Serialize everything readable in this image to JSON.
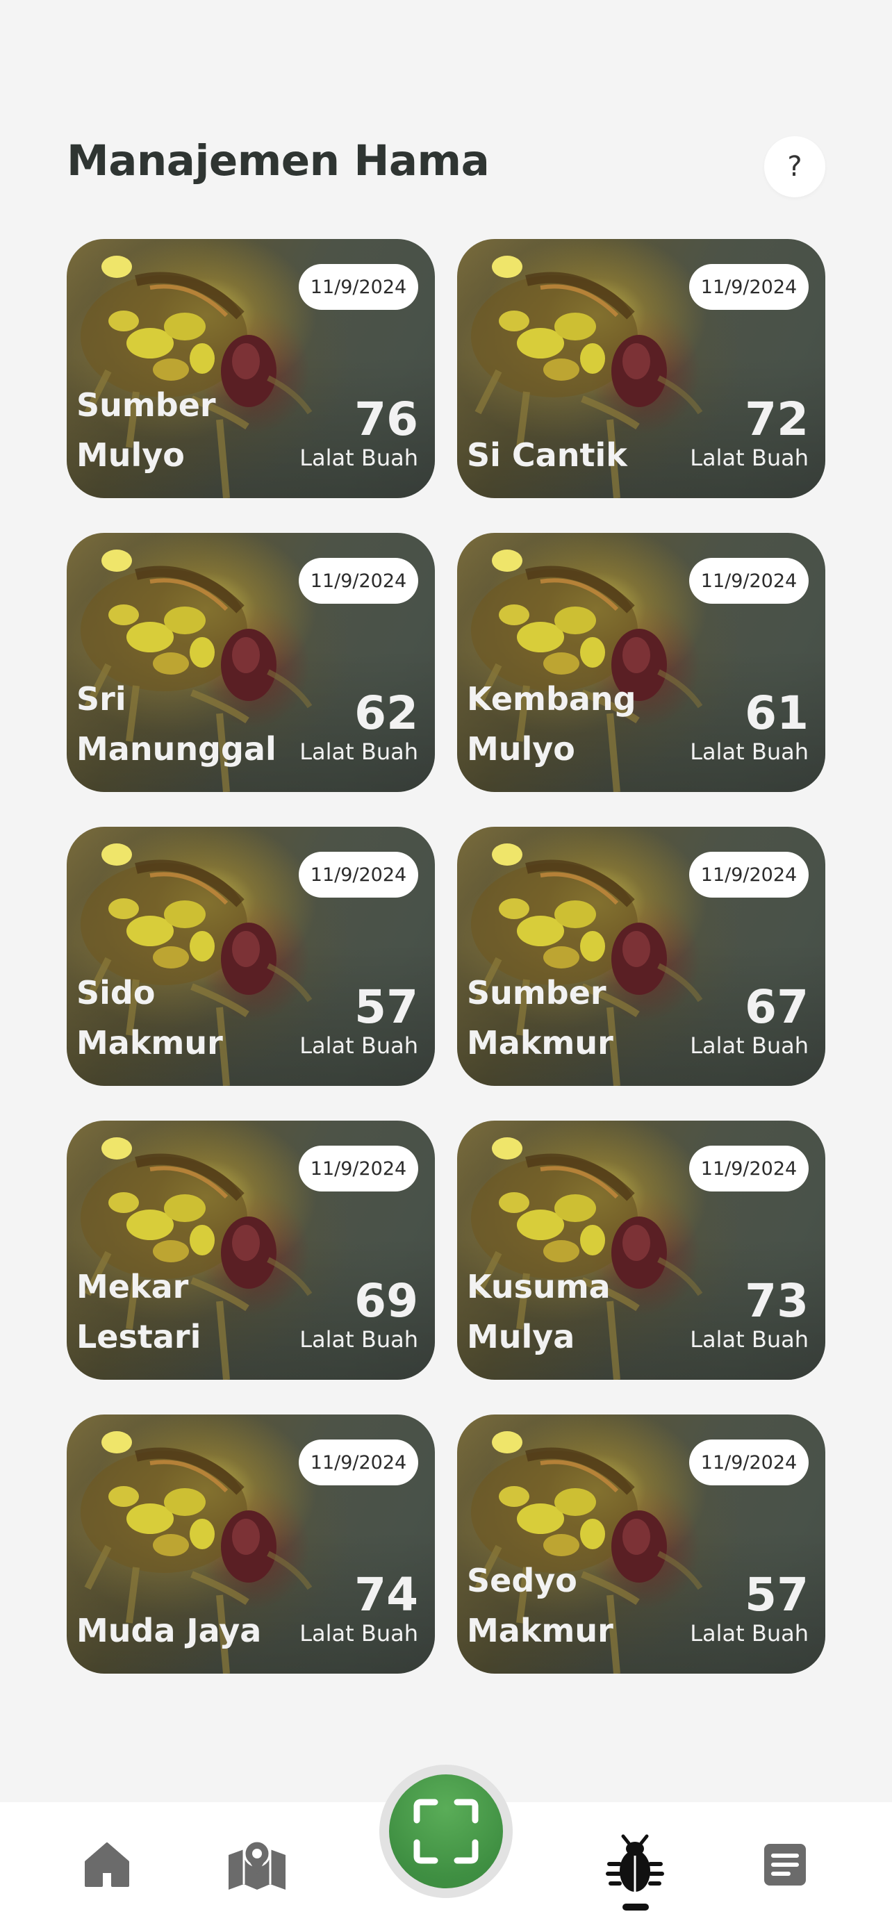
{
  "header": {
    "title": "Manajemen Hama",
    "help_label": "?"
  },
  "cards": [
    {
      "date": "11/9/2024",
      "name": "Sumber Mulyo",
      "count": "76",
      "unit": "Lalat Buah"
    },
    {
      "date": "11/9/2024",
      "name": "Si Cantik",
      "count": "72",
      "unit": "Lalat Buah"
    },
    {
      "date": "11/9/2024",
      "name": "Sri Manunggal",
      "count": "62",
      "unit": "Lalat Buah"
    },
    {
      "date": "11/9/2024",
      "name": "Kembang Mulyo",
      "count": "61",
      "unit": "Lalat Buah"
    },
    {
      "date": "11/9/2024",
      "name": "Sido Makmur",
      "count": "57",
      "unit": "Lalat Buah"
    },
    {
      "date": "11/9/2024",
      "name": "Sumber Makmur",
      "count": "67",
      "unit": "Lalat Buah"
    },
    {
      "date": "11/9/2024",
      "name": "Mekar Lestari",
      "count": "69",
      "unit": "Lalat Buah"
    },
    {
      "date": "11/9/2024",
      "name": "Kusuma Mulya",
      "count": "73",
      "unit": "Lalat Buah"
    },
    {
      "date": "11/9/2024",
      "name": "Muda Jaya",
      "count": "74",
      "unit": "Lalat Buah"
    },
    {
      "date": "11/9/2024",
      "name": "Sedyo Makmur",
      "count": "57",
      "unit": "Lalat Buah"
    }
  ],
  "bottom_nav": {
    "items": [
      {
        "icon": "home-icon"
      },
      {
        "icon": "map-icon"
      },
      {
        "icon": "scan-icon"
      },
      {
        "icon": "bug-icon",
        "active": true
      },
      {
        "icon": "document-icon"
      }
    ]
  },
  "colors": {
    "background": "#f4f4f4",
    "title": "#2f3532",
    "scan_button": "#3f8f42",
    "nav_icon": "#6b6b6b",
    "nav_icon_active": "#111111"
  }
}
